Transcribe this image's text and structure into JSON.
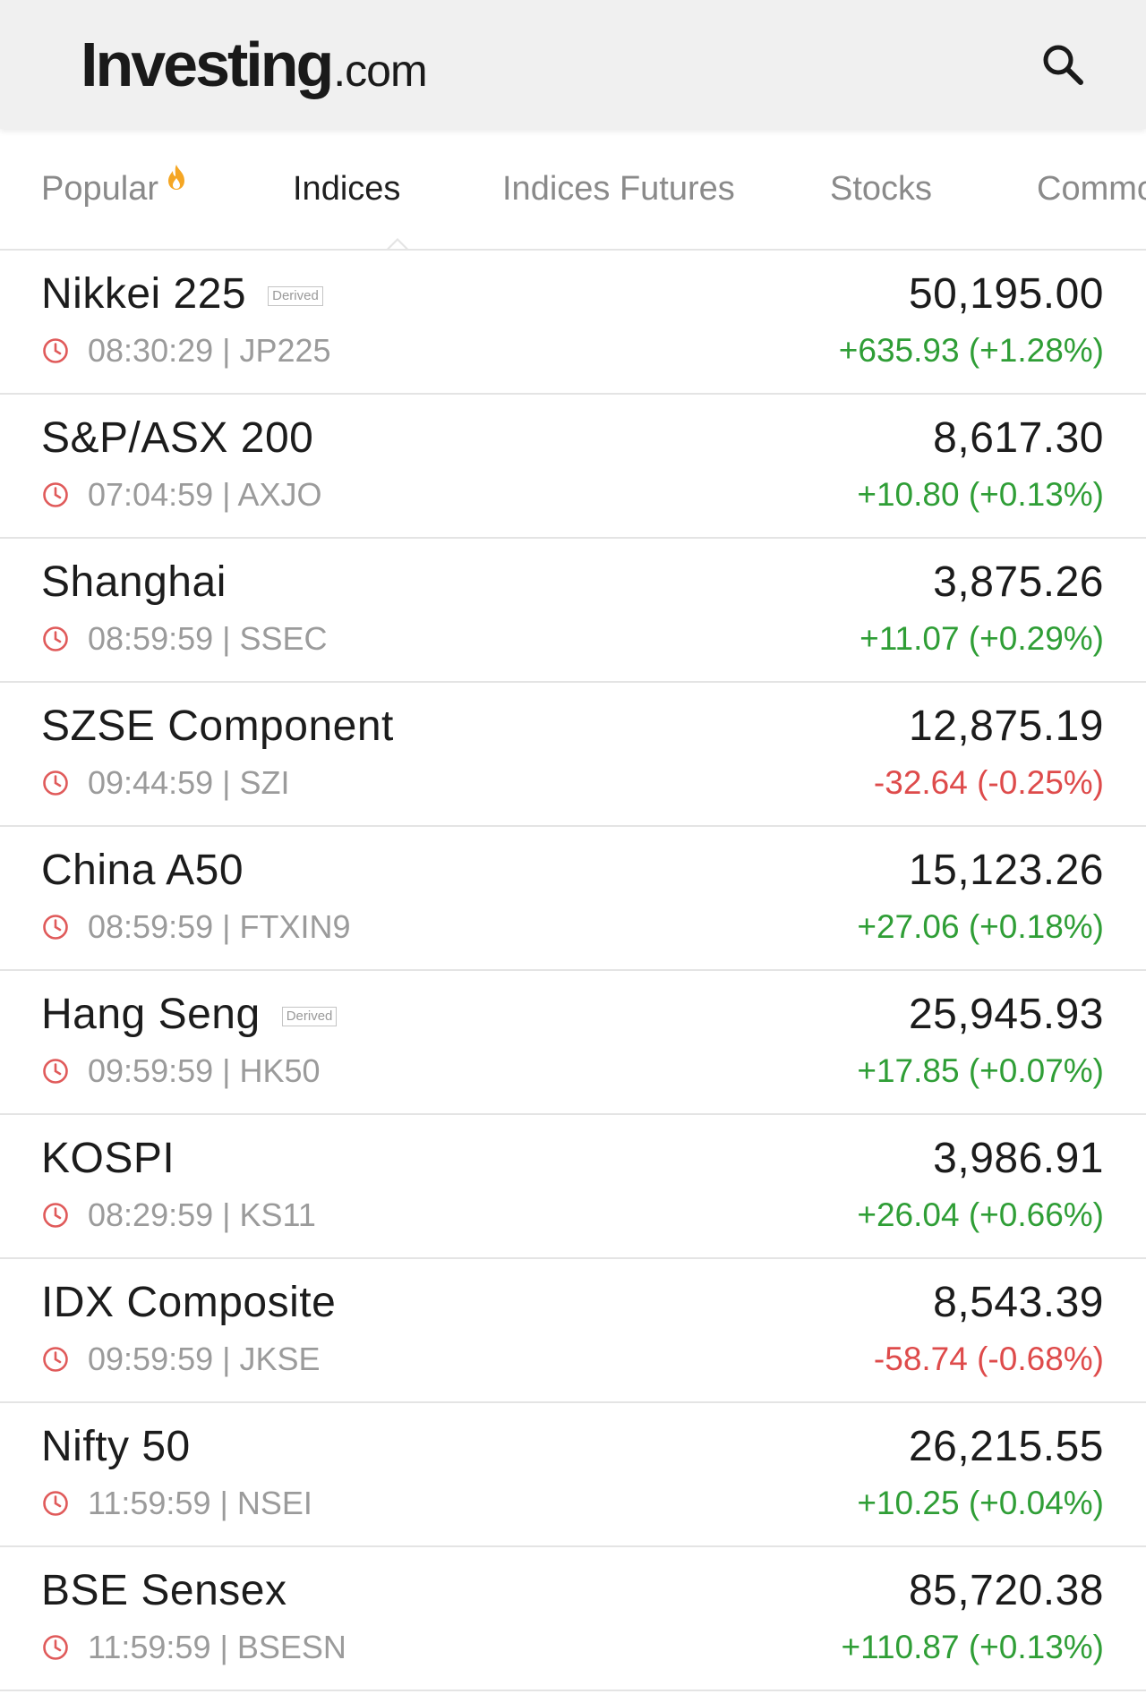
{
  "header": {
    "logo_main": "Investing",
    "logo_suffix": ".com",
    "search_icon": "search-icon"
  },
  "tabs": [
    {
      "label": "Popular",
      "icon": "fire-icon",
      "active": false
    },
    {
      "label": "Indices",
      "active": true
    },
    {
      "label": "Indices Futures",
      "active": false
    },
    {
      "label": "Stocks",
      "active": false
    },
    {
      "label": "Commo",
      "active": false
    }
  ],
  "colors": {
    "positive": "#2f9e36",
    "negative": "#de4b4b",
    "clock": "#e05a5a",
    "fire": "#f5a623"
  },
  "rows": [
    {
      "name": "Nikkei 225",
      "badge": "Derived",
      "time": "08:30:29",
      "symbol": "JP225",
      "meta": "08:30:29 | JP225",
      "price": "50,195.00",
      "change": "+635.93 (+1.28%)",
      "direction": "pos"
    },
    {
      "name": "S&P/ASX 200",
      "badge": "",
      "time": "07:04:59",
      "symbol": "AXJO",
      "meta": "07:04:59 | AXJO",
      "price": "8,617.30",
      "change": "+10.80 (+0.13%)",
      "direction": "pos"
    },
    {
      "name": "Shanghai",
      "badge": "",
      "time": "08:59:59",
      "symbol": "SSEC",
      "meta": "08:59:59 | SSEC",
      "price": "3,875.26",
      "change": "+11.07 (+0.29%)",
      "direction": "pos"
    },
    {
      "name": "SZSE Component",
      "badge": "",
      "time": "09:44:59",
      "symbol": "SZI",
      "meta": "09:44:59 | SZI",
      "price": "12,875.19",
      "change": "-32.64 (-0.25%)",
      "direction": "neg"
    },
    {
      "name": "China A50",
      "badge": "",
      "time": "08:59:59",
      "symbol": "FTXIN9",
      "meta": "08:59:59 | FTXIN9",
      "price": "15,123.26",
      "change": "+27.06 (+0.18%)",
      "direction": "pos"
    },
    {
      "name": "Hang Seng",
      "badge": "Derived",
      "time": "09:59:59",
      "symbol": "HK50",
      "meta": "09:59:59 | HK50",
      "price": "25,945.93",
      "change": "+17.85 (+0.07%)",
      "direction": "pos"
    },
    {
      "name": "KOSPI",
      "badge": "",
      "time": "08:29:59",
      "symbol": "KS11",
      "meta": "08:29:59 | KS11",
      "price": "3,986.91",
      "change": "+26.04 (+0.66%)",
      "direction": "pos"
    },
    {
      "name": "IDX Composite",
      "badge": "",
      "time": "09:59:59",
      "symbol": "JKSE",
      "meta": "09:59:59 | JKSE",
      "price": "8,543.39",
      "change": "-58.74 (-0.68%)",
      "direction": "neg"
    },
    {
      "name": "Nifty 50",
      "badge": "",
      "time": "11:59:59",
      "symbol": "NSEI",
      "meta": "11:59:59 | NSEI",
      "price": "26,215.55",
      "change": "+10.25 (+0.04%)",
      "direction": "pos"
    },
    {
      "name": "BSE Sensex",
      "badge": "",
      "time": "11:59:59",
      "symbol": "BSESN",
      "meta": "11:59:59 | BSESN",
      "price": "85,720.38",
      "change": "+110.87 (+0.13%)",
      "direction": "pos"
    }
  ]
}
